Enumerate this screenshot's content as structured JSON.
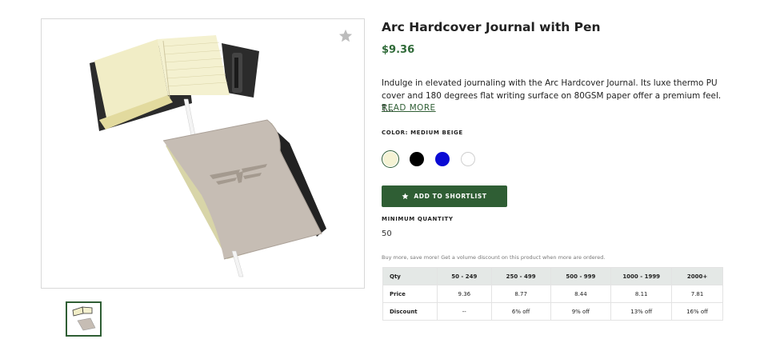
{
  "product": {
    "title": "Arc Hardcover Journal with Pen",
    "price": "$9.36",
    "description": "Indulge in elevated journaling with the Arc Hardcover Journal. Its luxe thermo PU cover and 180 degrees flat writing surface on 80GSM paper offer a premium feel. T...",
    "read_more": "READ MORE",
    "color_label": "COLOR: MEDIUM BEIGE",
    "colors": [
      "#f5f3d4",
      "#000000",
      "#0a0ad4",
      "#ffffff"
    ],
    "shortlist_label": "ADD TO SHORTLIST",
    "min_qty_label": "MINIMUM QUANTITY",
    "min_qty_value": "50",
    "volume_note": "Buy more, save more! Get a volume discount on this product when more are ordered."
  },
  "pricing_table": {
    "headers": [
      "Qty",
      "50 - 249",
      "250 - 499",
      "500 - 999",
      "1000 - 1999",
      "2000+"
    ],
    "rows": [
      [
        "Price",
        "9.36",
        "8.77",
        "8.44",
        "8.11",
        "7.81"
      ],
      [
        "Discount",
        "--",
        "6% off",
        "9% off",
        "13% off",
        "16% off"
      ]
    ]
  },
  "icons": {
    "favorite": "star-icon",
    "shortlist": "star-icon"
  },
  "colors": {
    "brand_green": "#2f5e34",
    "price_green": "#2f6a38"
  }
}
